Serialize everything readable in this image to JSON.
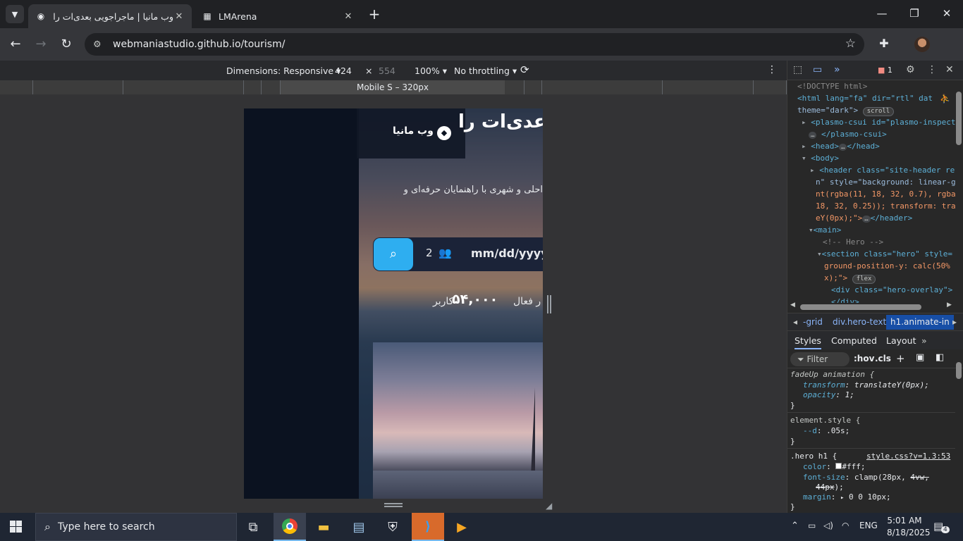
{
  "browser": {
    "tabs": [
      {
        "title": "وب مانیا | ماجراجویی بعدی‌ات را پ",
        "active": true
      },
      {
        "title": "LMArena",
        "active": false
      }
    ],
    "url": "webmaniastudio.github.io/tourism/"
  },
  "device_toolbar": {
    "dimensions_label": "Dimensions: Responsive",
    "width": "424",
    "times": "×",
    "height": "554",
    "zoom": "100%",
    "throttling": "No throttling",
    "ruler_label": "Mobile S – 320px"
  },
  "page": {
    "brand": "وب مانیا",
    "hero_title": "عدی‌ات را",
    "hero_subtitle": "احلی و شهری با راهنمایان حرفه‌ای و",
    "date_placeholder": "mm/dd/yyyy",
    "guests": "2",
    "stat_value": "۵۴,۰۰۰",
    "stat_label": "کاربر",
    "stat2_label": "ر فعال"
  },
  "devtools": {
    "issues_count": "1",
    "elements": {
      "doctype": "<!DOCTYPE html>",
      "html_tag": "<html lang=\"fa\" dir=\"rtl\" dat",
      "theme_attr": "theme=\"dark\">",
      "scroll_badge": "scroll",
      "plasmo_open": "<plasmo-csui id=\"plasmo-inspecto",
      "plasmo_close": "</plasmo-csui>",
      "head": "<head>",
      "head_close": "</head>",
      "body": "<body>",
      "header_l1": "<header class=\"site-header rev",
      "header_l2": "n\" style=\"background: linear-g",
      "header_l3": "nt(rgba(11, 18, 32, 0.7), rgba",
      "header_l4": "18, 32, 0.25)); transform: tra",
      "header_l5": "eY(0px);\">",
      "header_close": "</header>",
      "main": "<main>",
      "comment": "<!-- Hero -->",
      "section_l1": "<section class=\"hero\" style=",
      "section_l2": "ground-position-y: calc(50%",
      "section_l3": "x);\">",
      "flex_badge": "flex",
      "overlay_l1": "<div class=\"hero-overlay\">",
      "overlay_l2": "</div>",
      "ellipsis": "…"
    },
    "breadcrumbs": [
      "-grid",
      "div.hero-text",
      "h1.animate-in"
    ],
    "style_tabs": [
      "Styles",
      "Computed",
      "Layout"
    ],
    "filter_placeholder": "Filter",
    "hov": ":hov",
    "cls": ".cls",
    "rules": {
      "r1_selector": "fadeUp animation {",
      "r1_p1": "transform",
      "r1_v1": "translateY(0px);",
      "r1_p2": "opacity",
      "r1_v2": "1;",
      "brace_close": "}",
      "r2_selector": "element.style {",
      "r2_p1": "--d",
      "r2_v1": ".05s;",
      "r3_selector": ".hero h1 {",
      "r3_source": "style.css?v=1.3:53",
      "r3_p1": "color",
      "r3_v1": "#fff;",
      "r3_p2": "font-size",
      "r3_v2a": "clamp(28px,",
      "r3_v2b": "4vw,",
      "r3_v2c": "44px",
      "r3_v2d": ");",
      "r3_p3": "margin",
      "r3_v3": "0 0 10px;"
    }
  },
  "taskbar": {
    "search_placeholder": "Type here to search",
    "lang": "ENG",
    "time": "5:01 AM",
    "date": "8/18/2025",
    "notifications": "4"
  }
}
